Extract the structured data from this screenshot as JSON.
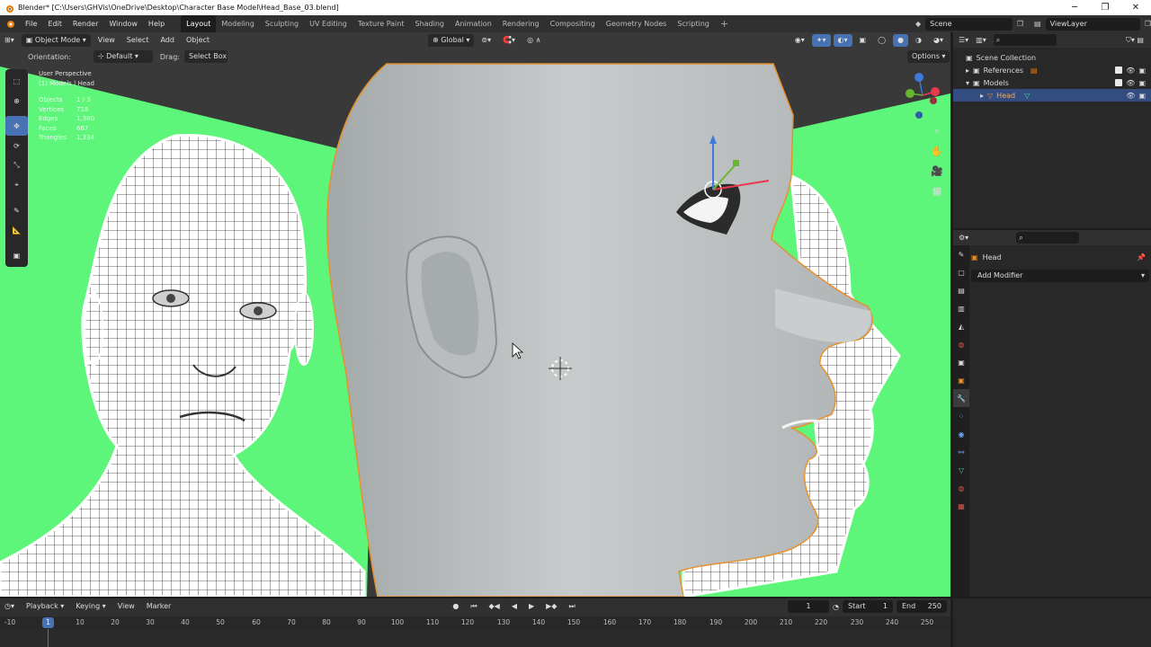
{
  "title_bar": {
    "title": "Blender* [C:\\Users\\GHVis\\OneDrive\\Desktop\\Character Base Model\\Head_Base_03.blend]",
    "minimize": "─",
    "maximize": "❐",
    "close": "✕"
  },
  "menu": [
    "File",
    "Edit",
    "Render",
    "Window",
    "Help"
  ],
  "workspaces": [
    "Layout",
    "Modeling",
    "Sculpting",
    "UV Editing",
    "Texture Paint",
    "Shading",
    "Animation",
    "Rendering",
    "Compositing",
    "Geometry Nodes",
    "Scripting"
  ],
  "active_workspace": "Layout",
  "add_workspace": "+",
  "scene": {
    "label": "Scene",
    "view_layer": "ViewLayer"
  },
  "viewport_header": {
    "mode": "Object Mode",
    "menus": [
      "View",
      "Select",
      "Add",
      "Object"
    ],
    "transform_orientation": "Global",
    "orientation_label": "Orientation:",
    "orientation_value": "Default",
    "drag_label": "Drag:",
    "drag_value": "Select Box",
    "options": "Options"
  },
  "overlay_stats": {
    "view_name": "User Perspective",
    "collection": "(1) Models | Head",
    "rows": [
      {
        "k": "Objects",
        "v": "1 / 3"
      },
      {
        "k": "Vertices",
        "v": "718"
      },
      {
        "k": "Edges",
        "v": "1,380"
      },
      {
        "k": "Faces",
        "v": "667"
      },
      {
        "k": "Triangles",
        "v": "1,334"
      }
    ]
  },
  "outliner": {
    "root": "Scene Collection",
    "items": [
      {
        "label": "References",
        "selected": false,
        "indent": 1
      },
      {
        "label": "Models",
        "selected": false,
        "indent": 1
      },
      {
        "label": "Head",
        "selected": true,
        "indent": 2
      }
    ]
  },
  "properties": {
    "object_name": "Head",
    "add_modifier": "Add Modifier"
  },
  "timeline": {
    "menus": [
      "Playback",
      "Keying",
      "View",
      "Marker"
    ],
    "current_frame": "1",
    "start_label": "Start",
    "start": "1",
    "end_label": "End",
    "end": "250",
    "ruler": [
      "-10",
      "1",
      "10",
      "20",
      "30",
      "40",
      "50",
      "60",
      "70",
      "80",
      "90",
      "100",
      "110",
      "120",
      "130",
      "140",
      "150",
      "160",
      "170",
      "180",
      "190",
      "200",
      "210",
      "220",
      "230",
      "240",
      "250"
    ]
  },
  "colors": {
    "accent": "#4772b3",
    "green_screen": "#5df57a",
    "selection_orange": "#e8902c"
  }
}
